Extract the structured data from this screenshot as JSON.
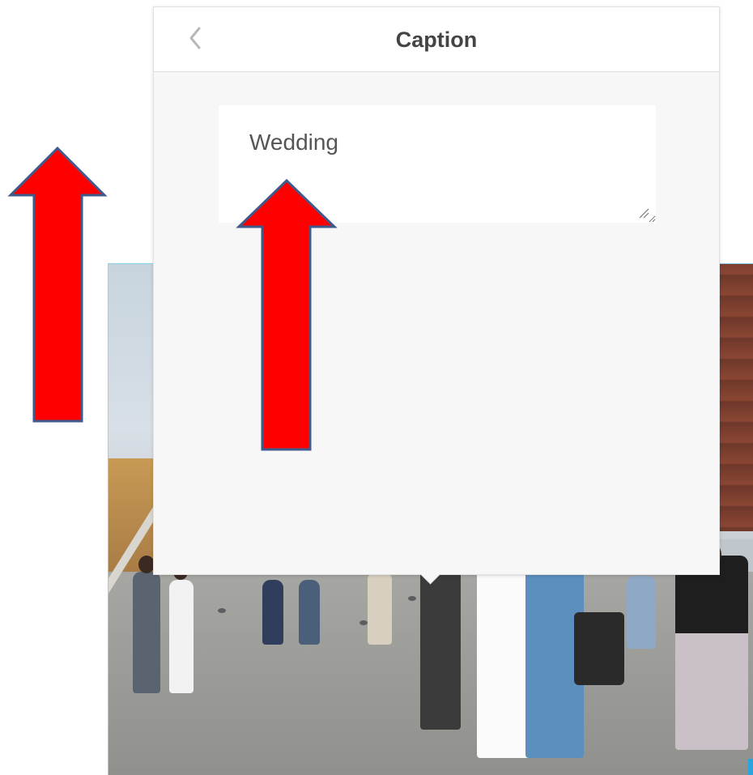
{
  "caption_dialog": {
    "title": "Caption",
    "input_value": "Wedding"
  },
  "icons": {
    "back": "chevron-left-icon",
    "resize": "resize-grip-icon",
    "annotation": "red-up-arrow-icon"
  },
  "colors": {
    "annotation_arrow_fill": "#ff0000",
    "annotation_arrow_stroke": "#3f5a8c",
    "panel_background": "#f7f7f7",
    "photo_border": "#8fd3ef"
  }
}
